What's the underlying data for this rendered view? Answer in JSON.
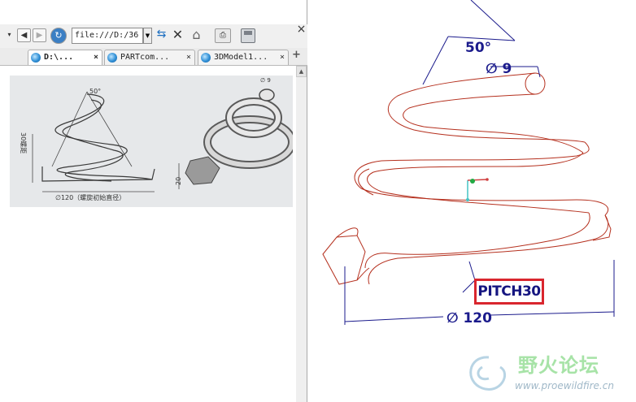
{
  "browser": {
    "address": "file:///D:/36",
    "tabs": [
      {
        "label": "D:\\...",
        "active": true
      },
      {
        "label": "PARTcom...",
        "active": false
      },
      {
        "label": "3DModel1...",
        "active": false
      }
    ],
    "close_glyph": "×",
    "new_tab_glyph": "+",
    "panel_close_glyph": "×",
    "icons": [
      "back-icon",
      "forward-icon",
      "history-icon",
      "refresh-icon",
      "stop-icon",
      "home-icon",
      "print-icon",
      "save-icon"
    ]
  },
  "sketch": {
    "angle_label": "50°",
    "diameter_label": "∅120（螺旋初始直径）",
    "pitch_label": "30螺距",
    "height_label": "20",
    "wire_label": "∅ 9"
  },
  "cad": {
    "angle_dim": "50°",
    "wire_dim": "∅ 9",
    "pitch_label": "PITCH30",
    "diameter_dim": "∅ 120",
    "colors": {
      "coil": "#b5301e",
      "dimension": "#1b1b8c",
      "highlight": "#d9262e"
    }
  },
  "watermark": {
    "text": "野火论坛",
    "url": "www.proewildfire.cn"
  }
}
